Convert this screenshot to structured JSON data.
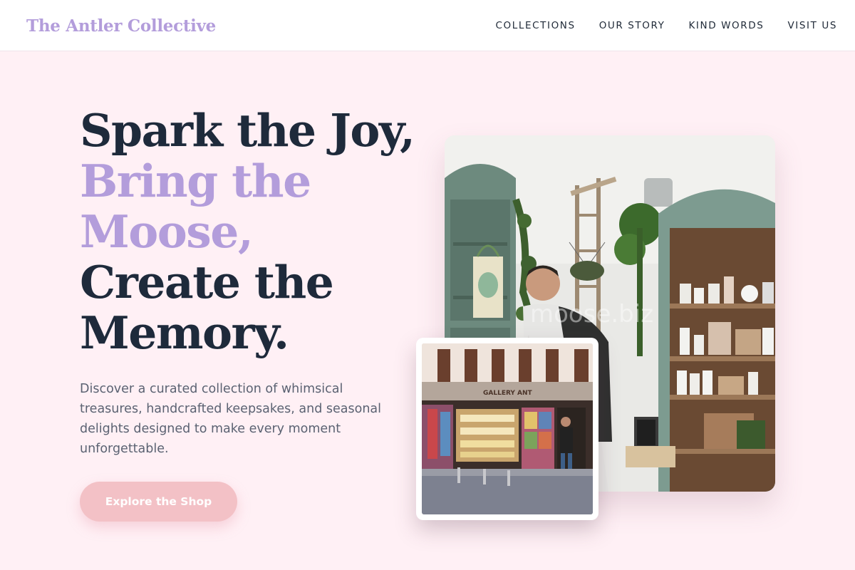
{
  "brand": {
    "name": "The Antler Collective"
  },
  "nav": {
    "items": [
      {
        "label": "COLLECTIONS"
      },
      {
        "label": "OUR STORY"
      },
      {
        "label": "KIND WORDS"
      },
      {
        "label": "VISIT US"
      }
    ]
  },
  "hero": {
    "line1": "Spark the Joy,",
    "line2": "Bring the",
    "line3": "Moose,",
    "line4": "Create the",
    "line5": "Memory.",
    "description": "Discover a curated collection of whimsical treasures, handcrafted keepsakes, and seasonal delights designed to make every moment unforgettable.",
    "cta_label": "Explore the Shop"
  },
  "images": {
    "main_watermark": "moose.biz",
    "storefront_sign": "GALLERY ANT"
  },
  "colors": {
    "page_background": "#fff0f5",
    "accent_lavender": "#b39ddb",
    "headline_dark": "#1e2a3b",
    "cta_pink": "#f3c1c6"
  }
}
